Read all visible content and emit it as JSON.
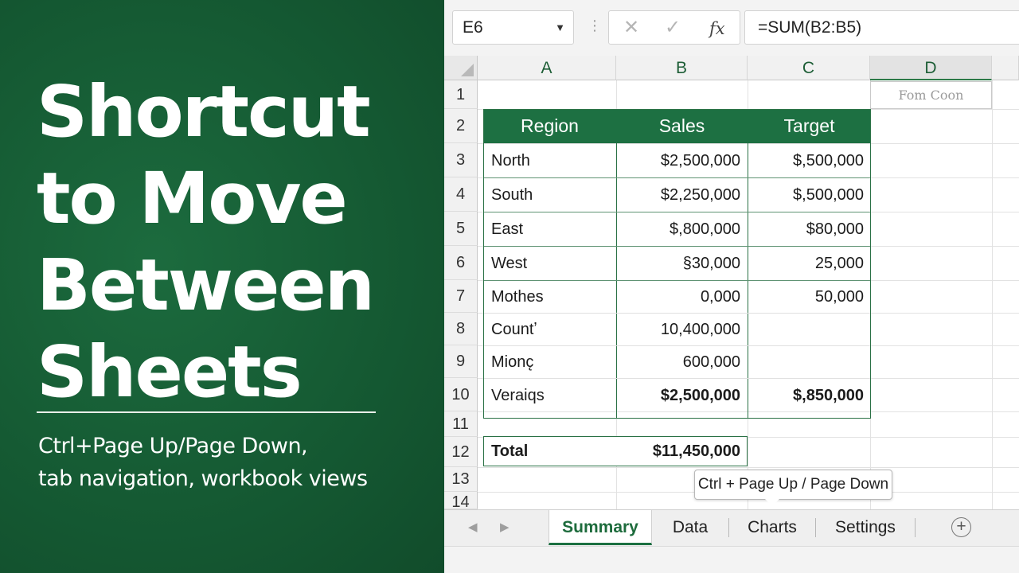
{
  "hero": {
    "title_lines": [
      "Shortcut",
      "to Move",
      "Between",
      "Sheets"
    ],
    "subtitle_lines": [
      "Ctrl+Page Up/Page Down,",
      "tab navigation, workbook views"
    ]
  },
  "formula_bar": {
    "name_box": "E6",
    "cancel_icon": "✕",
    "enter_icon": "✓",
    "fx_label": "fx",
    "formula": "=SUM(B2:B5)"
  },
  "grid": {
    "columns": [
      "A",
      "B",
      "C",
      "D"
    ],
    "rows": [
      "1",
      "2",
      "3",
      "4",
      "5",
      "6",
      "7",
      "8",
      "9",
      "10",
      "11",
      "12",
      "13",
      "14"
    ],
    "d1_text": "Fom Coon"
  },
  "table": {
    "headers": [
      "Region",
      "Sales",
      "Target"
    ],
    "rows": [
      {
        "region": "North",
        "sales": "$2,500,000",
        "target": "$,500,000"
      },
      {
        "region": "South",
        "sales": "$2,250,000",
        "target": "$,500,000"
      },
      {
        "region": "East",
        "sales": "$,800,000",
        "target": "$80,000"
      },
      {
        "region": "West",
        "sales": "§30,000",
        "target": "25,000"
      },
      {
        "region": "Mothes",
        "sales": "0,000",
        "target": "50,000"
      },
      {
        "region": "Countʼ",
        "sales": "10,400,000",
        "target": ""
      },
      {
        "region": "Mionc̨",
        "sales": "600,000",
        "target": ""
      },
      {
        "region": "Veraiqs",
        "sales": "$2,500,000",
        "target": "$,850,000"
      }
    ],
    "total_label": "Total",
    "total_value": "$11,450,000"
  },
  "tooltip": "Ctrl + Page Up / Page Down",
  "tabs": {
    "prev_icon": "◀",
    "next_icon": "▶",
    "items": [
      "Summary",
      "Data",
      "Charts",
      "Settings"
    ],
    "active": "Summary",
    "add_icon": "+"
  },
  "colors": {
    "panel_green": "#155a33",
    "header_green": "#1d7042",
    "accent_green": "#2a7145"
  }
}
